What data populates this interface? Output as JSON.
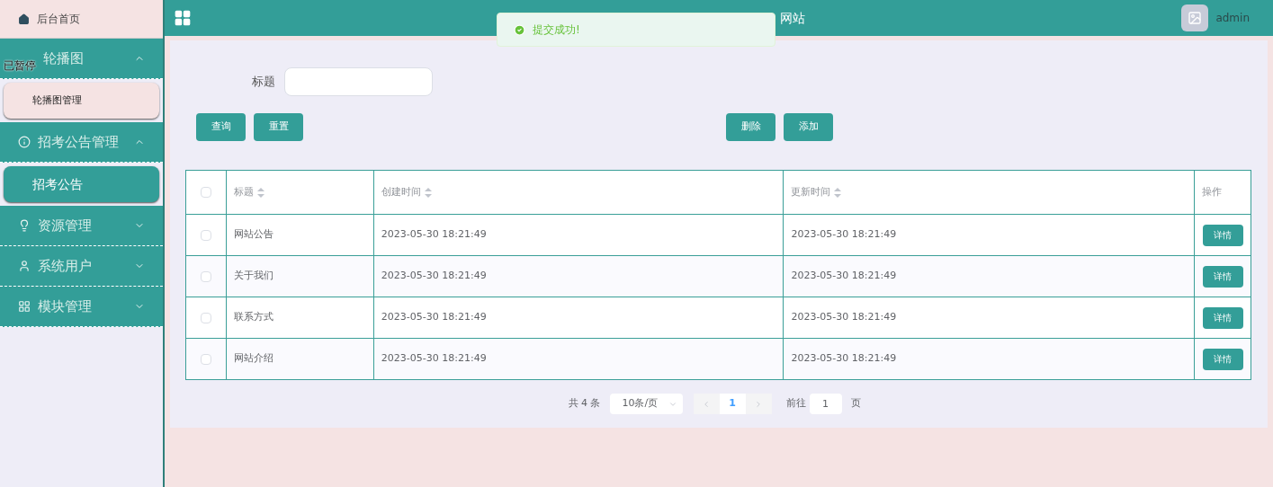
{
  "overlay_label": "已暂停",
  "sidebar": {
    "home": {
      "label": "后台首页"
    },
    "groups": [
      {
        "label": "轮播图",
        "expanded": true,
        "children": [
          {
            "label": "轮播图管理",
            "selected": false
          }
        ]
      },
      {
        "label": "招考公告管理",
        "expanded": true,
        "children": [
          {
            "label": "招考公告",
            "selected": true
          }
        ]
      },
      {
        "label": "资源管理",
        "expanded": false
      },
      {
        "label": "系统用户",
        "expanded": false
      },
      {
        "label": "模块管理",
        "expanded": false
      }
    ]
  },
  "header": {
    "title": "网站",
    "user": "admin"
  },
  "toast": {
    "message": "提交成功!"
  },
  "search": {
    "label": "标题"
  },
  "buttons_left": [
    "查询",
    "重置"
  ],
  "buttons_right": [
    "删除",
    "添加"
  ],
  "table": {
    "select_all_checked": false,
    "columns": [
      {
        "label": "标题"
      },
      {
        "label": "创建时间"
      },
      {
        "label": "更新时间"
      },
      {
        "label": "操作"
      }
    ],
    "rows": [
      {
        "checked": false,
        "cells": [
          "网站公告",
          "2023-05-30 18:21:49",
          "2023-05-30 18:21:49"
        ],
        "action": "详情"
      },
      {
        "checked": false,
        "cells": [
          "关于我们",
          "2023-05-30 18:21:49",
          "2023-05-30 18:21:49"
        ],
        "action": "详情"
      },
      {
        "checked": false,
        "cells": [
          "联系方式",
          "2023-05-30 18:21:49",
          "2023-05-30 18:21:49"
        ],
        "action": "详情"
      },
      {
        "checked": false,
        "cells": [
          "网站介绍",
          "2023-05-30 18:21:49",
          "2023-05-30 18:21:49"
        ],
        "action": "详情"
      }
    ]
  },
  "pagination": {
    "total": "共 4 条",
    "page_size": "10条/页",
    "pages": [
      {
        "label": "1",
        "selected": true
      }
    ],
    "goto_label": "前往",
    "goto_value": "1",
    "page_suffix": "页"
  }
}
